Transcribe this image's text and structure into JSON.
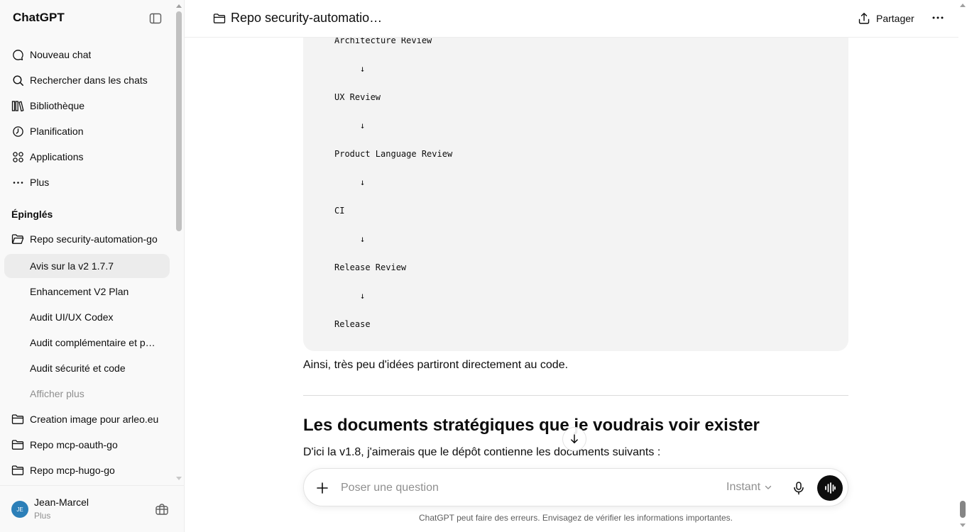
{
  "sidebar": {
    "brand": "ChatGPT",
    "nav": [
      {
        "label": "Nouveau chat",
        "icon": "new-chat-icon"
      },
      {
        "label": "Rechercher dans les chats",
        "icon": "search-icon"
      },
      {
        "label": "Bibliothèque",
        "icon": "library-icon"
      },
      {
        "label": "Planification",
        "icon": "clock-icon"
      },
      {
        "label": "Applications",
        "icon": "apps-grid-icon"
      },
      {
        "label": "Plus",
        "icon": "more-dots-icon"
      }
    ],
    "pinned_title": "Épinglés",
    "project": {
      "label": "Repo security-automation-go",
      "icon": "folder-open-icon"
    },
    "project_chats": [
      {
        "label": "Avis sur la v2 1.7.7",
        "active": true
      },
      {
        "label": "Enhancement V2 Plan"
      },
      {
        "label": "Audit UI/UX Codex"
      },
      {
        "label": "Audit complémentaire et p…"
      },
      {
        "label": "Audit sécurité et code"
      }
    ],
    "show_more": "Afficher plus",
    "folders": [
      {
        "label": "Creation image pour arleo.eu",
        "icon": "folder-icon"
      },
      {
        "label": "Repo mcp-oauth-go",
        "icon": "folder-icon"
      },
      {
        "label": "Repo mcp-hugo-go",
        "icon": "folder-icon"
      }
    ],
    "user": {
      "name": "Jean-Marcel",
      "plan": "Plus",
      "initials": "JE"
    }
  },
  "header": {
    "project_title": "Repo security-automatio…",
    "share_label": "Partager"
  },
  "conversation": {
    "code_lines": [
      "Architecture Review",
      "↓",
      "UX Review",
      "↓",
      "Product Language Review",
      "↓",
      "CI",
      "↓",
      "Release Review",
      "↓",
      "Release"
    ],
    "paragraph_1": "Ainsi, très peu d'idées partiront directement au code.",
    "heading": "Les documents stratégiques que je voudrais voir exister",
    "paragraph_2": "D'ici la v1.8, j'aimerais que le dépôt contienne les documents suivants :"
  },
  "composer": {
    "placeholder": "Poser une question",
    "model": "Instant"
  },
  "disclaimer": "ChatGPT peut faire des erreurs. Envisagez de vérifier les informations importantes.",
  "colors": {
    "active_item_bg": "#ececec",
    "sidebar_bg": "#f9f9f9",
    "code_bg": "#f3f3f3",
    "avatar_bg": "#2c7fb8",
    "voice_btn_bg": "#0d0d0d"
  }
}
